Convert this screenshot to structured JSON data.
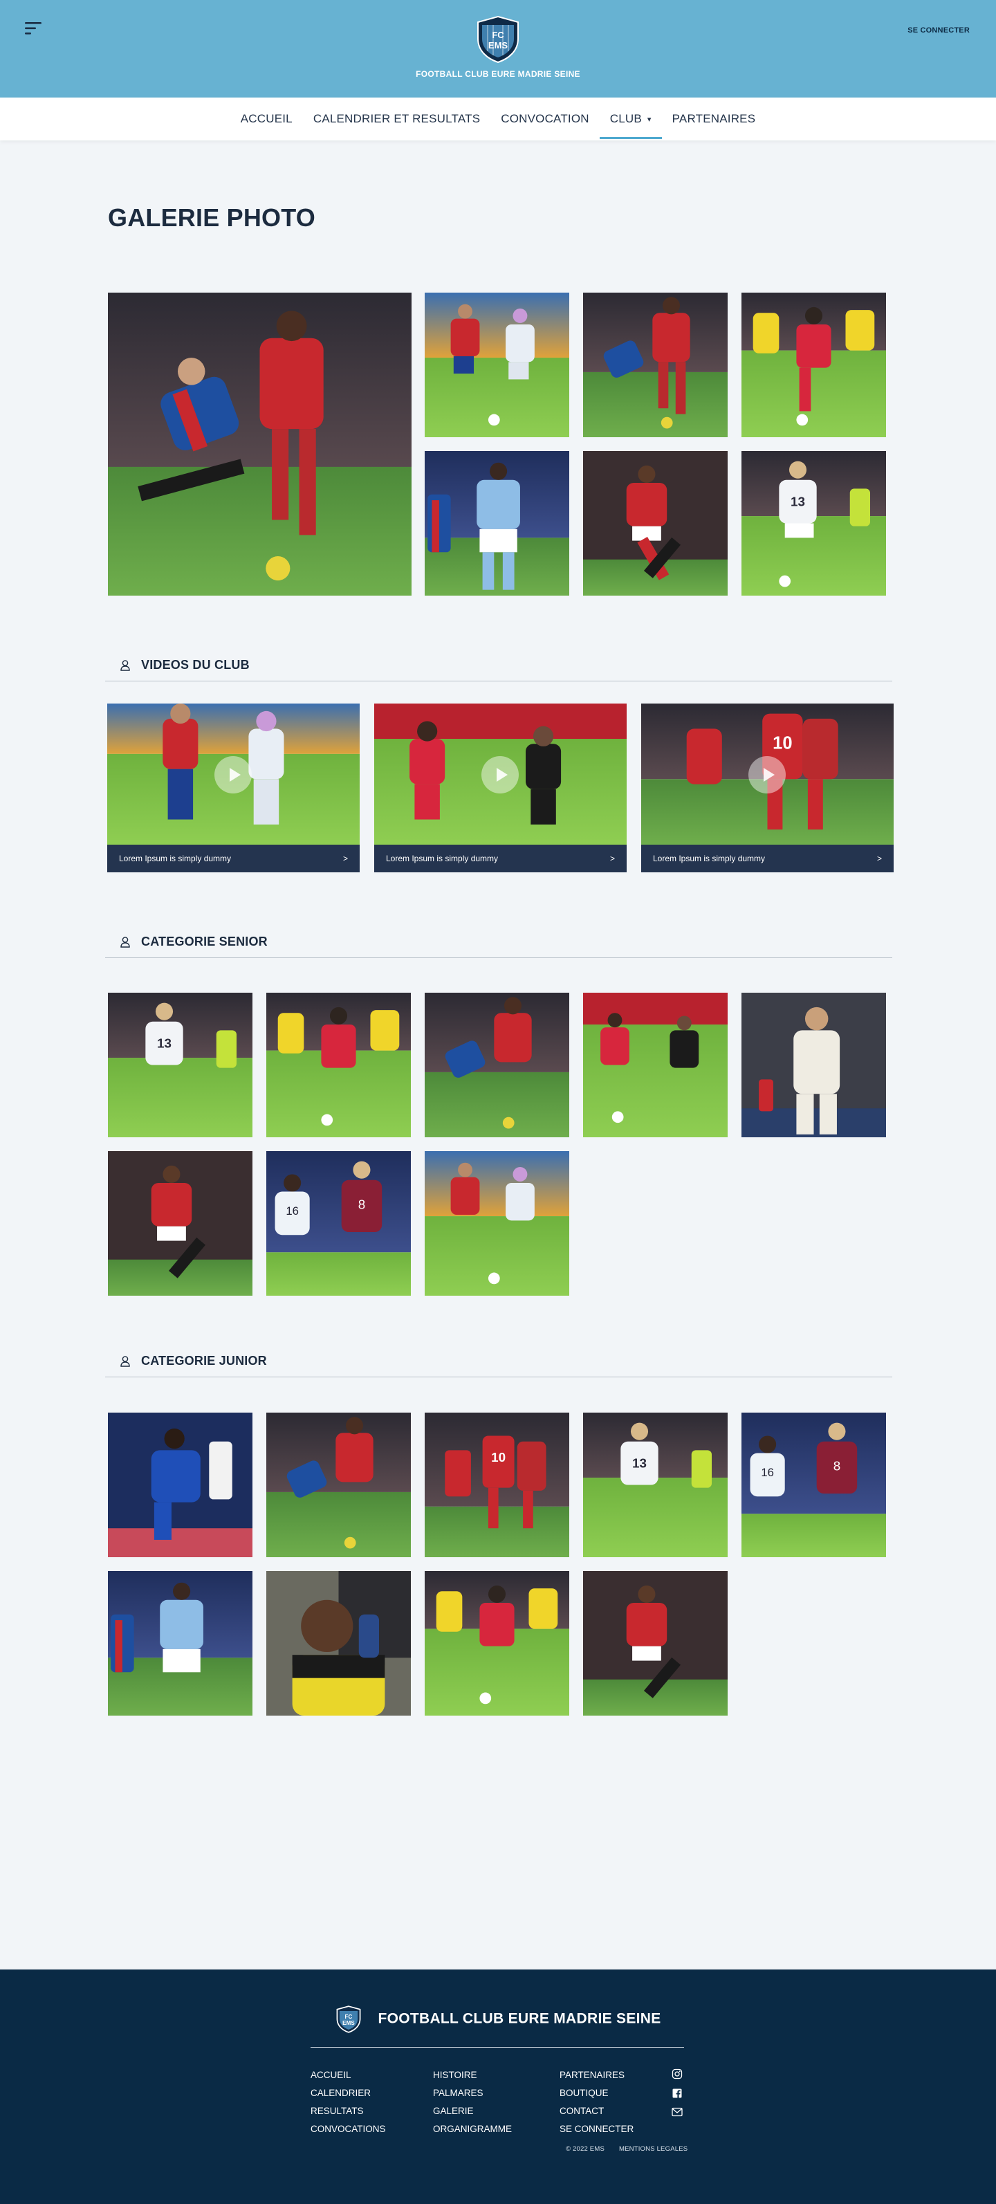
{
  "header": {
    "brand": "FOOTBALL CLUB EURE MADRIE SEINE",
    "logo_letters": [
      "FC",
      "EMS"
    ],
    "login": "SE CONNECTER",
    "bg_color": "#67b2d2"
  },
  "nav": {
    "items": [
      {
        "label": "ACCUEIL"
      },
      {
        "label": "CALENDRIER ET RESULTATS"
      },
      {
        "label": "CONVOCATION"
      },
      {
        "label": "CLUB",
        "has_dropdown": true,
        "active": true
      },
      {
        "label": "PARTENAIRES"
      }
    ],
    "caret": "▾",
    "accent": "#4fa9cf"
  },
  "page": {
    "title": "GALERIE PHOTO"
  },
  "sections": {
    "videos": {
      "label": "VIDEOS DU CLUB",
      "items": [
        {
          "caption": "Lorem Ipsum is simply dummy",
          "arrow": ">"
        },
        {
          "caption": "Lorem Ipsum is simply dummy",
          "arrow": ">"
        },
        {
          "caption": "Lorem Ipsum is simply dummy",
          "arrow": ">"
        }
      ]
    },
    "senior": {
      "label": "CATEGORIE SENIOR"
    },
    "junior": {
      "label": "CATEGORIE JUNIOR"
    }
  },
  "footer": {
    "brand": "FOOTBALL CLUB EURE MADRIE SEINE",
    "columns": [
      [
        "ACCUEIL",
        "CALENDRIER",
        "RESULTATS",
        "CONVOCATIONS"
      ],
      [
        "HISTOIRE",
        "PALMARES",
        "GALERIE",
        "ORGANIGRAMME"
      ],
      [
        "PARTENAIRES",
        "BOUTIQUE",
        "CONTACT",
        "SE CONNECTER"
      ]
    ],
    "social_icons": [
      "instagram-icon",
      "facebook-icon",
      "mail-icon"
    ],
    "copyright": "© 2022 EMS",
    "legal": "MENTIONS LEGALES",
    "bg_color": "#0a2a45"
  }
}
